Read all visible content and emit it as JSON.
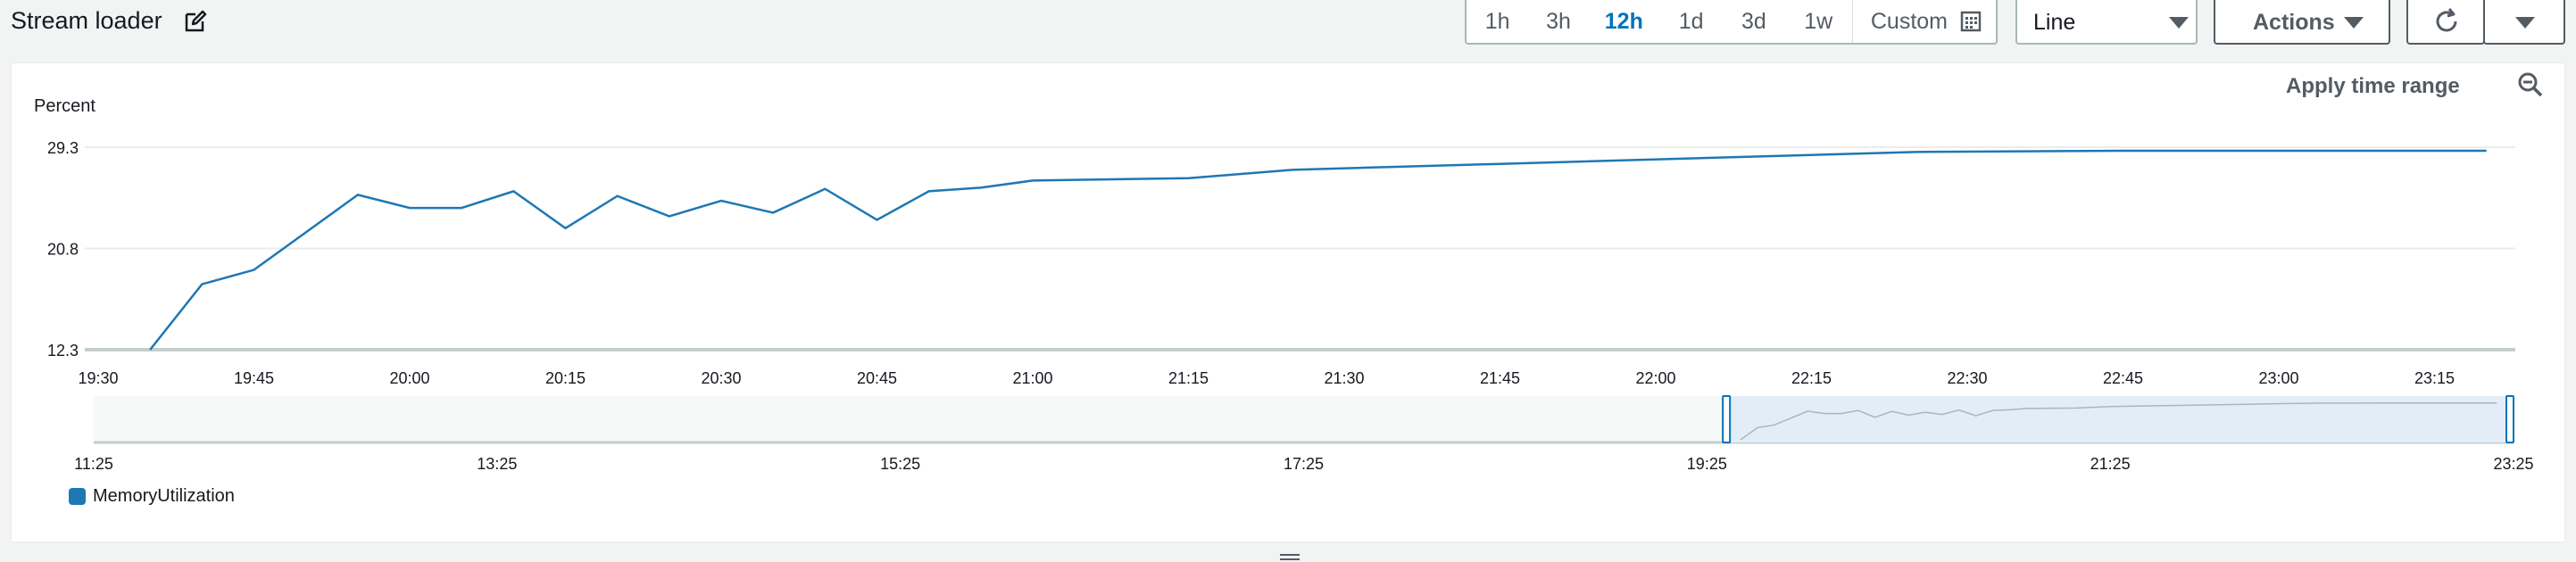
{
  "header": {
    "title": "Stream loader",
    "time_ranges": [
      "1h",
      "3h",
      "12h",
      "1d",
      "3d",
      "1w"
    ],
    "active_range": "12h",
    "custom_label": "Custom",
    "view_type": "Line",
    "actions_label": "Actions"
  },
  "widget": {
    "apply_time_range": "Apply time range",
    "unit_label": "Percent",
    "legend": "MemoryUtilization",
    "series_color": "#1f77b4"
  },
  "chart_data": {
    "type": "line",
    "ylabel": "Percent",
    "ylim": [
      12.3,
      29.3
    ],
    "y_ticks": [
      12.3,
      20.8,
      29.3
    ],
    "x_ticks": [
      "19:30",
      "19:45",
      "20:00",
      "20:15",
      "20:30",
      "20:45",
      "21:00",
      "21:15",
      "21:30",
      "21:45",
      "22:00",
      "22:15",
      "22:30",
      "22:45",
      "23:00",
      "23:15"
    ],
    "x_domain_minutes": [
      "19:30",
      "23:25"
    ],
    "series": [
      {
        "name": "MemoryUtilization",
        "x": [
          "19:35",
          "19:40",
          "19:45",
          "19:55",
          "20:00",
          "20:05",
          "20:10",
          "20:15",
          "20:20",
          "20:25",
          "20:30",
          "20:35",
          "20:40",
          "20:45",
          "20:50",
          "20:55",
          "21:00",
          "21:15",
          "21:25",
          "21:45",
          "22:05",
          "22:25",
          "22:45",
          "23:00",
          "23:20"
        ],
        "values": [
          12.3,
          17.8,
          19.0,
          25.3,
          24.2,
          24.2,
          25.6,
          22.5,
          25.2,
          23.5,
          24.8,
          23.8,
          25.8,
          23.2,
          25.6,
          25.9,
          26.5,
          26.7,
          27.4,
          27.9,
          28.4,
          28.9,
          29.0,
          29.0,
          29.0
        ]
      }
    ],
    "grid": true,
    "legend_position": "bottom-left",
    "navigator": {
      "x_ticks": [
        "11:25",
        "13:25",
        "15:25",
        "17:25",
        "19:25",
        "21:25",
        "23:25"
      ],
      "selected_range": [
        "19:30",
        "23:25"
      ]
    }
  }
}
